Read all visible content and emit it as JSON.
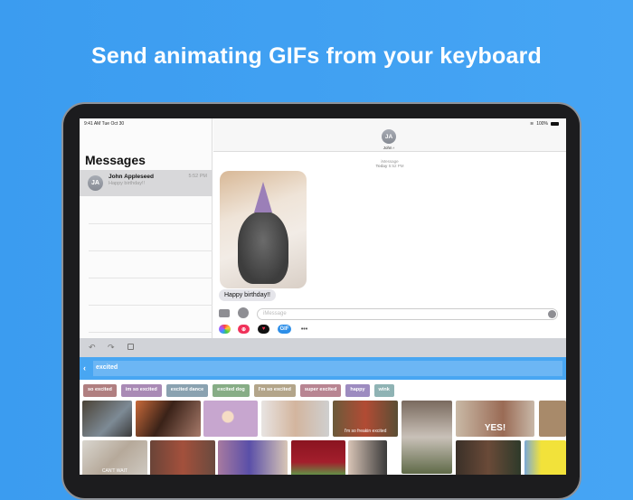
{
  "headline": "Send animating GIFs from your keyboard",
  "status": {
    "time": "9:41 AM  Tue Oct 30",
    "battery": "100%"
  },
  "sidebar": {
    "title": "Messages",
    "conversation": {
      "initials": "JA",
      "name": "John Appleseed",
      "preview": "Happy birthday!!",
      "time": "5:52 PM"
    }
  },
  "conversation": {
    "initials": "JA",
    "name": "John ›",
    "service": "iMessage",
    "timestamp_day": "Today",
    "timestamp_time": "5:52 PM",
    "message": "Happy birthday!!",
    "input_placeholder": "iMessage"
  },
  "apps": {
    "gif_label": "GIF",
    "more": "•••"
  },
  "keyboard": {
    "search_value": "excited",
    "tags": [
      {
        "label": "so excited",
        "color": "#b07f80"
      },
      {
        "label": "im so excited",
        "color": "#a98ab5"
      },
      {
        "label": "excited dance",
        "color": "#8aa2b0"
      },
      {
        "label": "excited dog",
        "color": "#87ad86"
      },
      {
        "label": "I'm so excited",
        "color": "#b3a58a"
      },
      {
        "label": "super excited",
        "color": "#b88592"
      },
      {
        "label": "happy",
        "color": "#9d8cc0"
      },
      {
        "label": "wink",
        "color": "#8fb3b4"
      }
    ],
    "gif_captions": [
      "I'm so freakin excited",
      "YES!",
      "CAN'T WAIT"
    ]
  }
}
